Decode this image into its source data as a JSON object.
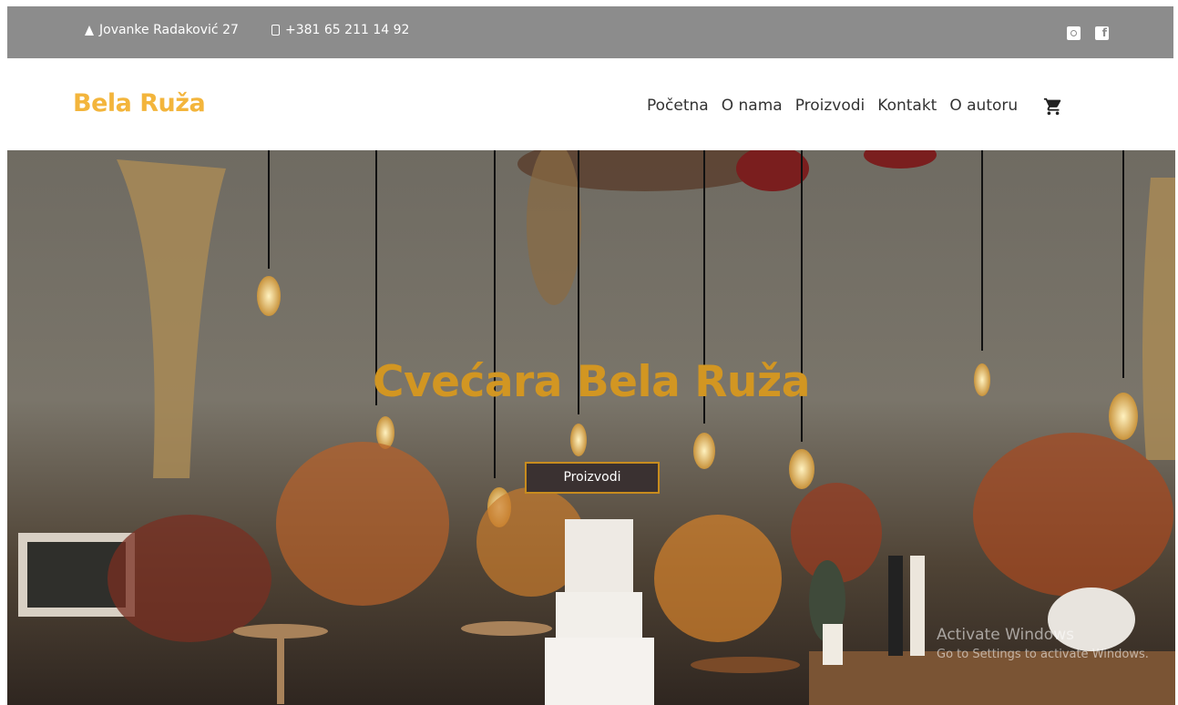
{
  "topbar": {
    "address": "Jovanke Radaković 27",
    "phone": "+381 65 211 14 92",
    "icons": [
      "location-icon",
      "phone-icon",
      "instagram-icon",
      "facebook-icon"
    ]
  },
  "nav": {
    "brand": "Bela Ruža",
    "links": [
      "Početna",
      "O nama",
      "Proizvodi",
      "Kontakt",
      "O autoru"
    ],
    "cart_icon": "cart-icon"
  },
  "hero": {
    "title": "Cvećara Bela Ruža",
    "button_label": "Proizvodi"
  },
  "watermark": {
    "line1": "Activate Windows",
    "line2": "Go to Settings to activate Windows."
  },
  "colors": {
    "brand": "#f3b53c",
    "hero_title": "#d29622",
    "topbar_bg": "#8c8c8c",
    "button_bg": "#3a3131",
    "button_border": "#c88c1e"
  }
}
